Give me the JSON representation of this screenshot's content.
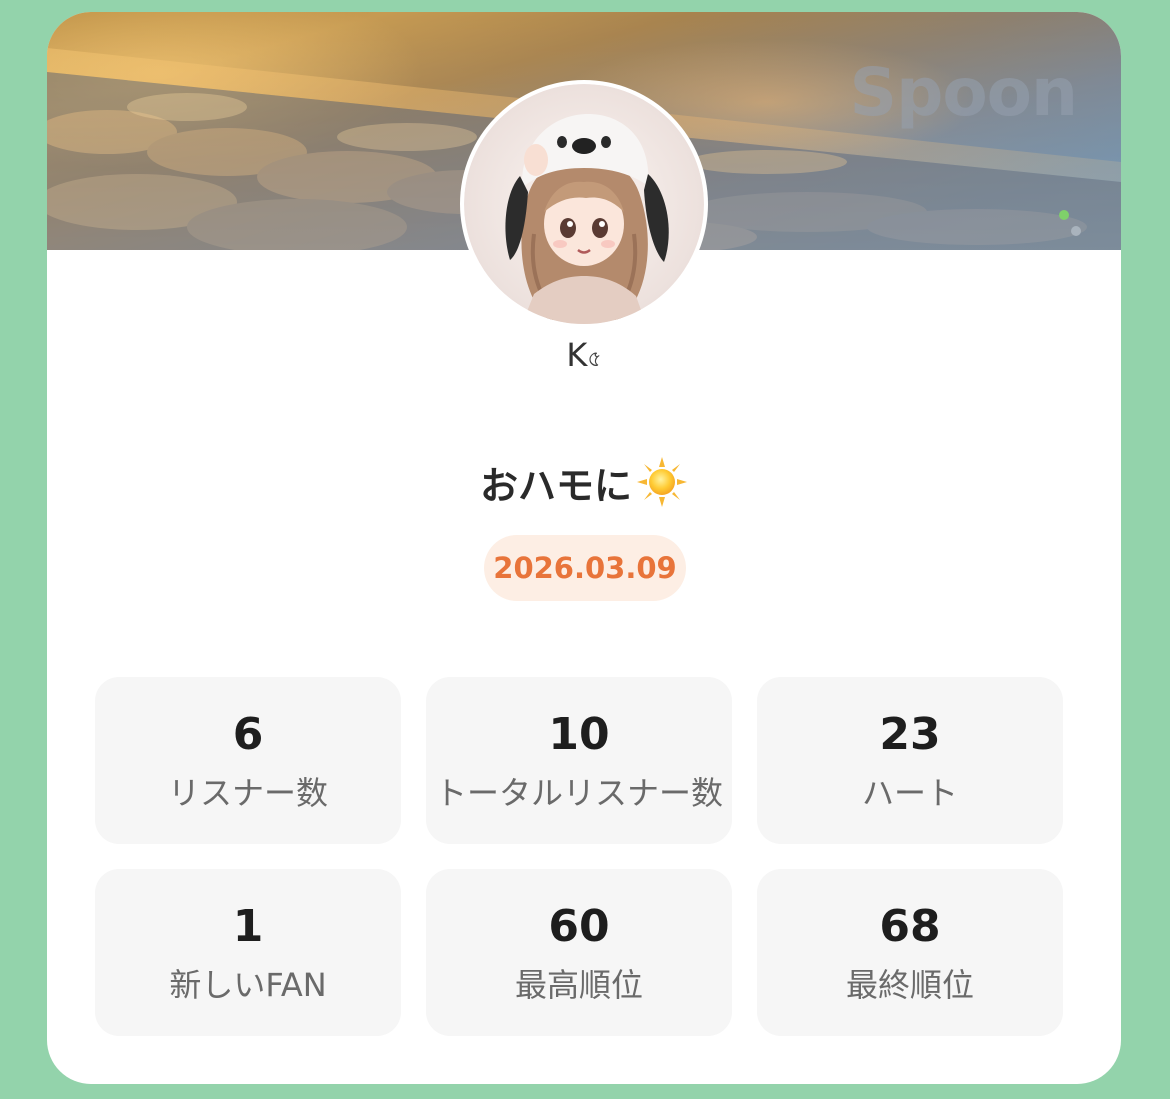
{
  "banner": {
    "watermark": "Spoon"
  },
  "profile": {
    "name": "K",
    "name_deco": "৫"
  },
  "broadcast": {
    "title": "おハモに",
    "title_icon": "sun-icon",
    "date": "2026.03.09"
  },
  "stats": [
    {
      "value": "6",
      "label": "リスナー数"
    },
    {
      "value": "10",
      "label": "トータルリスナー数"
    },
    {
      "value": "23",
      "label": "ハート"
    },
    {
      "value": "1",
      "label": "新しいFAN"
    },
    {
      "value": "60",
      "label": "最高順位"
    },
    {
      "value": "68",
      "label": "最終順位"
    }
  ],
  "colors": {
    "background": "#93d3ab",
    "card": "#ffffff",
    "date_text": "#e8743a",
    "date_pill": "#fdeee4",
    "stat_card": "#f6f6f6"
  }
}
